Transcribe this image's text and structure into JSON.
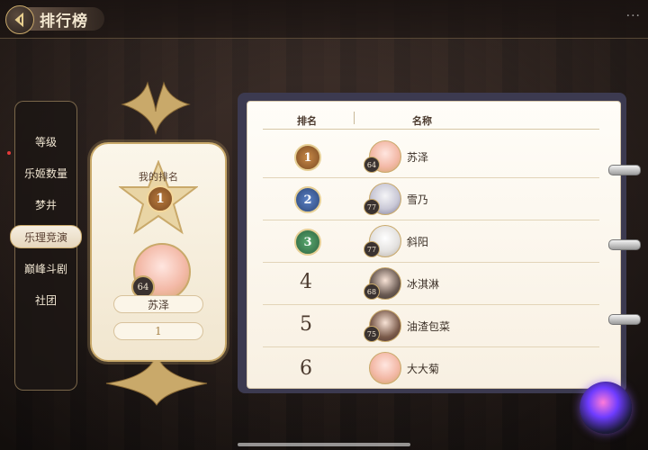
{
  "header": {
    "title": "排行榜",
    "back_icon": "back-arrow-icon"
  },
  "sidebar": {
    "items": [
      {
        "label": "等级",
        "active": false
      },
      {
        "label": "乐姬数量",
        "active": false
      },
      {
        "label": "梦井",
        "active": false
      },
      {
        "label": "乐理竞演",
        "active": true
      },
      {
        "label": "巅峰斗剧",
        "active": false
      },
      {
        "label": "社团",
        "active": false
      }
    ]
  },
  "my_rank": {
    "label": "我的排名",
    "rank": "1",
    "player_level": "64",
    "player_name": "苏泽",
    "score": "1"
  },
  "table": {
    "headers": {
      "rank": "排名",
      "name": "名称"
    },
    "rows": [
      {
        "rank": "1",
        "name": "苏泽",
        "level": "64",
        "medal": "gold"
      },
      {
        "rank": "2",
        "name": "雪乃",
        "level": "77",
        "medal": "blue"
      },
      {
        "rank": "3",
        "name": "斜阳",
        "level": "77",
        "medal": "green"
      },
      {
        "rank": "4",
        "name": "冰淇淋",
        "level": "68",
        "medal": ""
      },
      {
        "rank": "5",
        "name": "油渣包菜",
        "level": "75",
        "medal": ""
      },
      {
        "rank": "6",
        "name": "大大菊",
        "level": "",
        "medal": ""
      }
    ]
  },
  "colors": {
    "accent_gold": "#c9a96a",
    "medal_gold": "#b97a3c",
    "medal_blue": "#3d5e9b",
    "medal_green": "#3f8a55"
  }
}
